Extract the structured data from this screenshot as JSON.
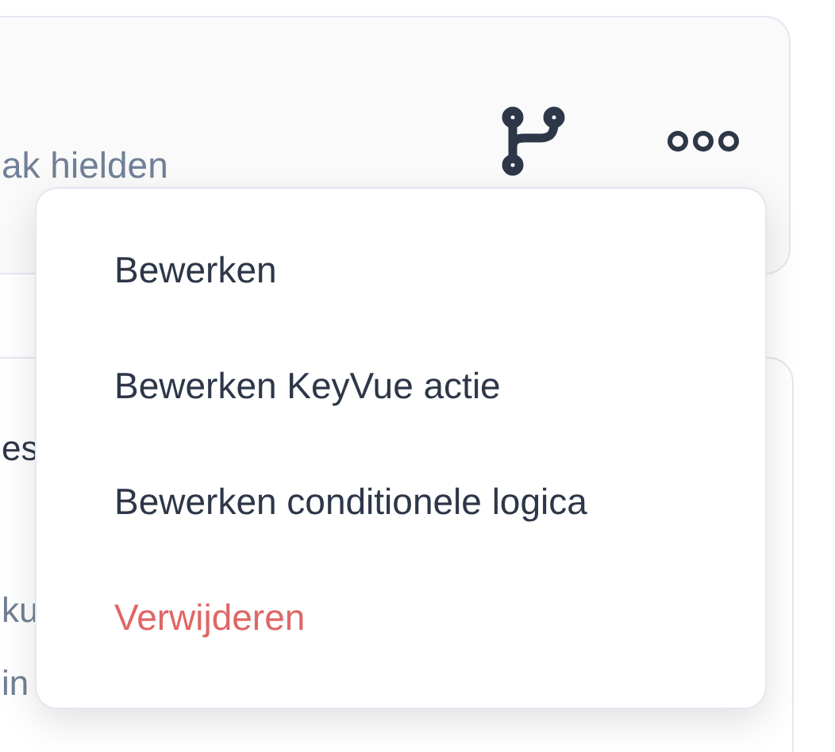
{
  "card_top": {
    "text": "ak hielden"
  },
  "card_bottom": {
    "lines": [
      {
        "text": "es",
        "kind": "title"
      },
      {
        "text": "ku",
        "kind": "body"
      },
      {
        "text": "in",
        "kind": "body"
      }
    ]
  },
  "menu": {
    "items": [
      {
        "label": "Bewerken",
        "kind": "normal"
      },
      {
        "label": "Bewerken KeyVue actie",
        "kind": "normal"
      },
      {
        "label": "Bewerken conditionele logica",
        "kind": "normal"
      },
      {
        "label": "Verwijderen",
        "kind": "danger"
      }
    ]
  }
}
